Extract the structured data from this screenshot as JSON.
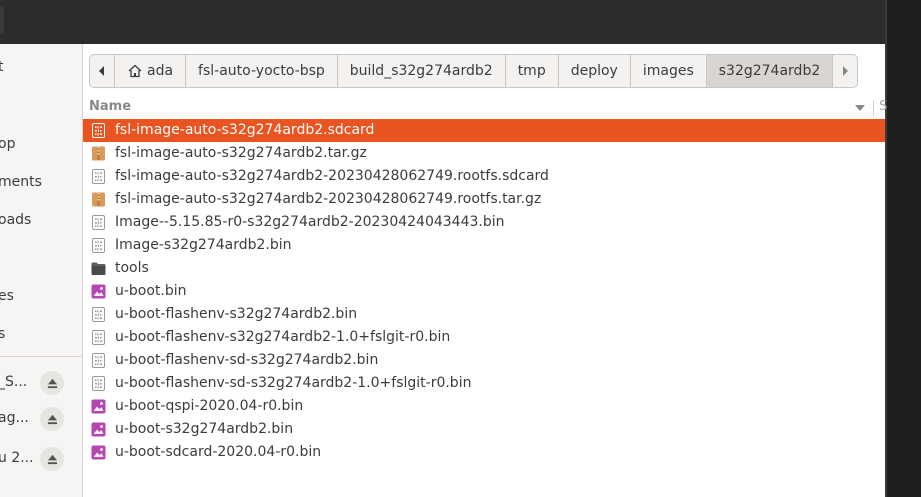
{
  "sidebar": {
    "items": [
      {
        "label": "t",
        "eject": false
      },
      {
        "label": "op",
        "eject": false
      },
      {
        "label": "ments",
        "eject": false
      },
      {
        "label": "oads",
        "eject": false
      },
      {
        "label": "es",
        "eject": false
      },
      {
        "label": "s",
        "eject": false
      },
      {
        "label": "_S...",
        "eject": true
      },
      {
        "label": "ag...",
        "eject": true
      },
      {
        "label": "u 2...",
        "eject": true
      }
    ]
  },
  "pathbar": {
    "crumbs": [
      "ada",
      "fsl-auto-yocto-bsp",
      "build_s32g274ardb2",
      "tmp",
      "deploy",
      "images",
      "s32g274ardb2"
    ]
  },
  "columns": {
    "name": "Name"
  },
  "files": [
    {
      "name": "fsl-image-auto-s32g274ardb2.sdcard",
      "icon": "binary-file-icon",
      "selected": true
    },
    {
      "name": "fsl-image-auto-s32g274ardb2.tar.gz",
      "icon": "archive-icon"
    },
    {
      "name": "fsl-image-auto-s32g274ardb2-20230428062749.rootfs.sdcard",
      "icon": "binary-file-icon"
    },
    {
      "name": "fsl-image-auto-s32g274ardb2-20230428062749.rootfs.tar.gz",
      "icon": "archive-icon"
    },
    {
      "name": "Image--5.15.85-r0-s32g274ardb2-20230424043443.bin",
      "icon": "binary-file-icon"
    },
    {
      "name": "Image-s32g274ardb2.bin",
      "icon": "binary-file-icon"
    },
    {
      "name": "tools",
      "icon": "folder-icon"
    },
    {
      "name": "u-boot.bin",
      "icon": "image-file-icon"
    },
    {
      "name": "u-boot-flashenv-s32g274ardb2.bin",
      "icon": "binary-file-icon"
    },
    {
      "name": "u-boot-flashenv-s32g274ardb2-1.0+fslgit-r0.bin",
      "icon": "binary-file-icon"
    },
    {
      "name": "u-boot-flashenv-sd-s32g274ardb2.bin",
      "icon": "binary-file-icon"
    },
    {
      "name": "u-boot-flashenv-sd-s32g274ardb2-1.0+fslgit-r0.bin",
      "icon": "binary-file-icon"
    },
    {
      "name": "u-boot-qspi-2020.04-r0.bin",
      "icon": "image-file-icon"
    },
    {
      "name": "u-boot-s32g274ardb2.bin",
      "icon": "image-file-icon"
    },
    {
      "name": "u-boot-sdcard-2020.04-r0.bin",
      "icon": "image-file-icon"
    }
  ],
  "colors": {
    "selection": "#e95420",
    "archive": "#d99a5e",
    "image": "#b346b0",
    "folder": "#5f5f5f"
  }
}
